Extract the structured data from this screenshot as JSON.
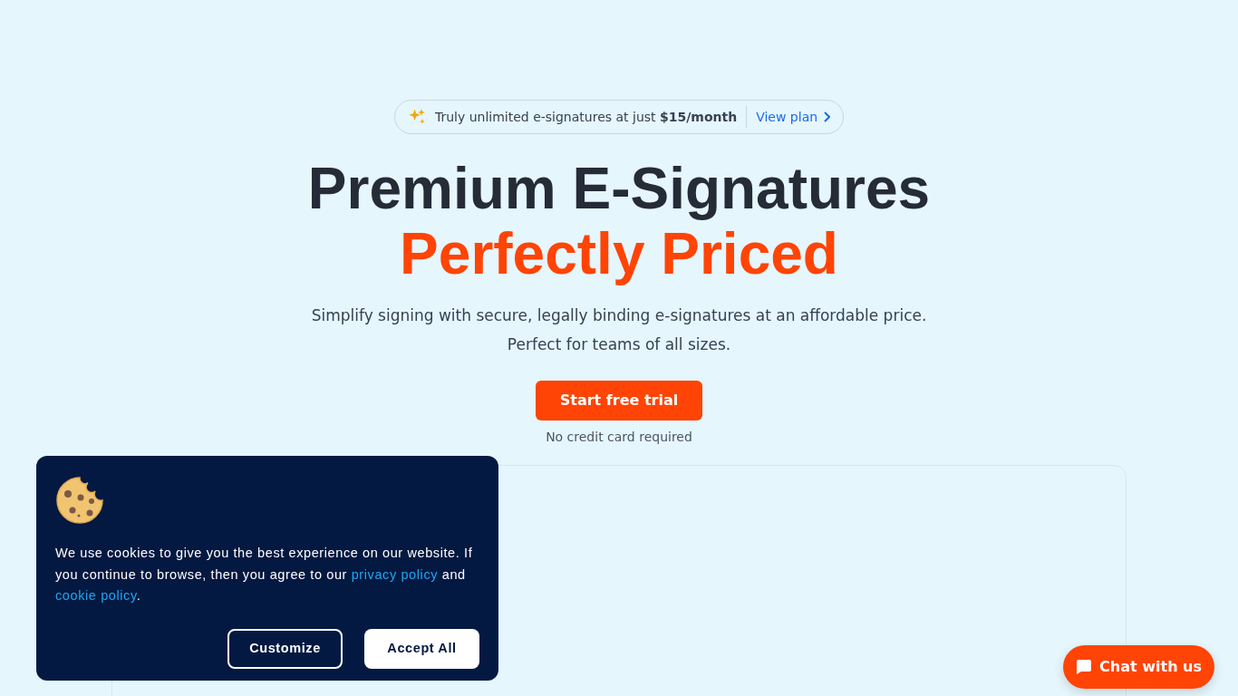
{
  "announcement": {
    "text": "Truly unlimited e-signatures at just **$15/month**",
    "link": "View plan"
  },
  "hero": {
    "title": "Premium E-Signatures",
    "title_accent": "Perfectly Priced",
    "subtitle_lines": [
      "Simplify signing with secure, legally binding e-signatures at an affordable price.",
      "Perfect for teams of all sizes."
    ],
    "cta": "Start free trial",
    "cta_note": "No credit card required"
  },
  "cookie_banner": {
    "message": [
      {
        "kind": "text",
        "text": "We use cookies to give you the best experience on our website. If you continue to browse, then you agree to our "
      },
      {
        "kind": "link",
        "text": "privacy policy"
      },
      {
        "kind": "text",
        "text": " and "
      },
      {
        "kind": "link",
        "text": "cookie policy"
      },
      {
        "kind": "text",
        "text": "."
      }
    ],
    "buttons": [
      {
        "label": "Customize",
        "kind": "outline"
      },
      {
        "label": "Accept All",
        "kind": "solid"
      }
    ]
  },
  "chat_button": {
    "label": "Chat with us"
  }
}
